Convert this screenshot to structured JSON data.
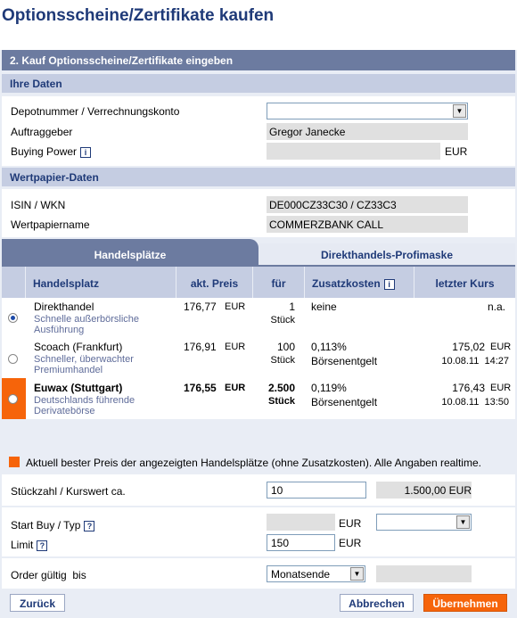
{
  "page": {
    "title": "Optionsscheine/Zertifikate kaufen",
    "step": "2. Kauf Optionsscheine/Zertifikate eingeben"
  },
  "ihre_daten": {
    "heading": "Ihre Daten",
    "depot_label": "Depotnummer / Verrechnungskonto",
    "depot_value": "",
    "auftraggeber_label": "Auftraggeber",
    "auftraggeber_value": "Gregor Janecke",
    "buying_power_label": "Buying Power",
    "buying_power_value": "",
    "currency": "EUR"
  },
  "wertpapier": {
    "heading": "Wertpapier-Daten",
    "isin_label": "ISIN / WKN",
    "isin_value": "DE000CZ33C30 / CZ33C3",
    "name_label": "Wertpapiername",
    "name_value": "COMMERZBANK CALL"
  },
  "tabs": {
    "active": "Handelsplätze",
    "inactive": "Direkthandels-Profimaske"
  },
  "table": {
    "headers": {
      "venue": "Handelsplatz",
      "price": "akt. Preis",
      "for": "für",
      "extra": "Zusatzkosten",
      "last": "letzter Kurs"
    },
    "rows": [
      {
        "name": "Direkthandel",
        "sub": "Schnelle außerbörsliche Ausführung",
        "price": "176,77",
        "cur": "EUR",
        "qty": "1",
        "unit": "Stück",
        "extra1": "keine",
        "extra2": "",
        "last": "n.a.",
        "last_cur": "",
        "last_date": ""
      },
      {
        "name": "Scoach (Frankfurt)",
        "sub": "Schneller, überwachter Premiumhandel",
        "price": "176,91",
        "cur": "EUR",
        "qty": "100",
        "unit": "Stück",
        "extra1": "0,113%",
        "extra2": "Börsenentgelt",
        "last": "175,02",
        "last_cur": "EUR",
        "last_date": "10.08.11  14:27"
      },
      {
        "name": "Euwax (Stuttgart)",
        "sub": "Deutschlands führende Derivatebörse",
        "price": "176,55",
        "cur": "EUR",
        "qty": "2.500",
        "unit": "Stück",
        "extra1": "0,119%",
        "extra2": "Börsenentgelt",
        "last": "176,43",
        "last_cur": "EUR",
        "last_date": "10.08.11  13:50"
      }
    ]
  },
  "legend": "Aktuell bester Preis der angezeigten Handelsplätze (ohne Zusatzkosten). Alle Angaben realtime.",
  "order": {
    "stueck_label": "Stückzahl /  Kurswert ca.",
    "stueck_value": "10",
    "kurswert": "1.500,00 EUR",
    "startbuy_label": "Start Buy / Typ",
    "startbuy_value": "",
    "startbuy_cur": "EUR",
    "typ_value": "",
    "limit_label": "Limit",
    "limit_value": "150",
    "limit_cur": "EUR",
    "gueltig_label": "Order gültig  bis",
    "gueltig_value": "Monatsende",
    "date_value": ""
  },
  "buttons": {
    "back": "Zurück",
    "cancel": "Abbrechen",
    "submit": "Übernehmen"
  },
  "colors": {
    "navy": "#1f3a78",
    "header_bar": "#6c7ba0",
    "section": "#c5cde2",
    "panel": "#e9edf5",
    "best_price": "#f6640a"
  }
}
